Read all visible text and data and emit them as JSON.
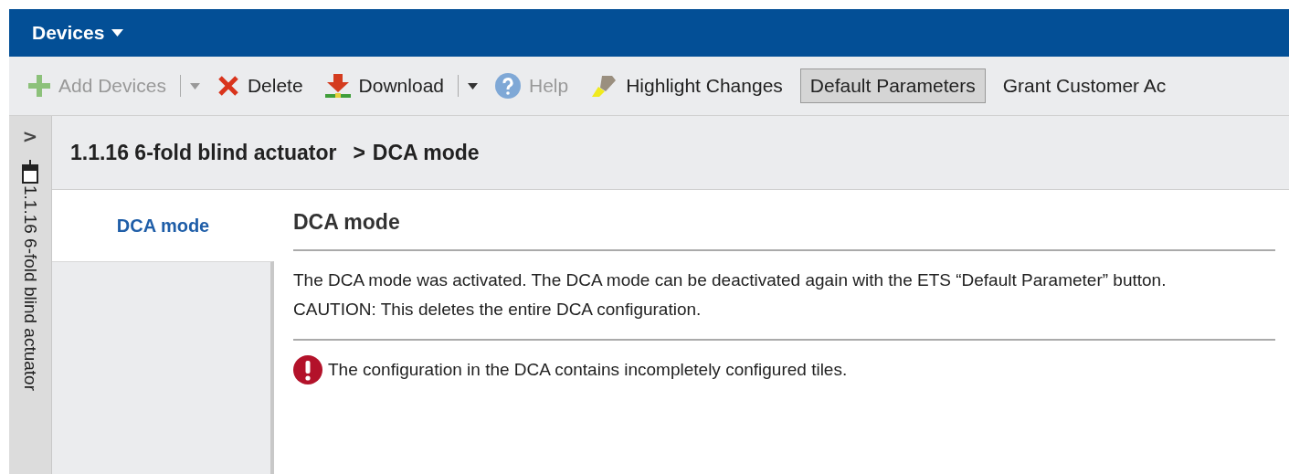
{
  "header": {
    "title": "Devices",
    "menu": true
  },
  "toolbar": [
    {
      "label": "Add Devices",
      "disabled": true,
      "pressed": false,
      "split": true
    },
    {
      "label": "Delete",
      "disabled": false,
      "pressed": false,
      "split": false
    },
    {
      "label": "Download",
      "disabled": false,
      "pressed": false,
      "split": true
    },
    {
      "label": "Help",
      "disabled": true,
      "pressed": false,
      "split": false
    },
    {
      "label": "Highlight Changes",
      "disabled": false,
      "pressed": false,
      "split": false
    },
    {
      "label": "Default Parameters",
      "disabled": false,
      "pressed": true,
      "split": false
    },
    {
      "label": "Grant Customer Ac",
      "disabled": false,
      "pressed": false,
      "split": false
    }
  ],
  "side_strip": {
    "expand": ">",
    "device": "1.1.16 6-fold blind actuator"
  },
  "breadcrumb": {
    "device": "1.1.16 6-fold blind actuator",
    "separator": ">",
    "page": "DCA mode"
  },
  "nav": [
    {
      "label": "DCA mode",
      "selected": true
    }
  ],
  "section": {
    "title": "DCA mode",
    "description": "The DCA mode was activated. The DCA mode can be deactivated again with the ETS “Default Parameter” button. CAUTION: This deletes the entire DCA configuration.",
    "error": "The configuration in the DCA contains incompletely configured tiles."
  }
}
